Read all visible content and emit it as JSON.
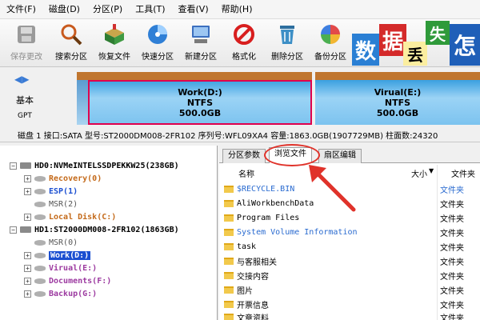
{
  "menu": [
    "文件(F)",
    "磁盘(D)",
    "分区(P)",
    "工具(T)",
    "查看(V)",
    "帮助(H)"
  ],
  "toolbar": {
    "save": "保存更改",
    "search": "搜索分区",
    "recover": "恢复文件",
    "quick": "快速分区",
    "new": "新建分区",
    "format": "格式化",
    "delete": "删除分区",
    "backup": "备份分区"
  },
  "ad_tiles": [
    "数",
    "据",
    "丢",
    "失",
    "怎"
  ],
  "disk_map": {
    "label1": "基本",
    "label2": "GPT",
    "partitions": [
      {
        "name": "Work(D:)",
        "fs": "NTFS",
        "size": "500.0GB"
      },
      {
        "name": "Virual(E:)",
        "fs": "NTFS",
        "size": "500.0GB"
      }
    ]
  },
  "info_line": "磁盘 1 接口:SATA  型号:ST2000DM008-2FR102  序列号:WFL09XA4  容量:1863.0GB(1907729MB)  柱面数:24320",
  "tree": {
    "hd0": "HD0:NVMeINTELSSDPEKKW25(238GB)",
    "hd0_parts": [
      "Recovery(0)",
      "ESP(1)",
      "MSR(2)",
      "Local Disk(C:)"
    ],
    "hd1": "HD1:ST2000DM008-2FR102(1863GB)",
    "hd1_parts": [
      "MSR(0)",
      "Work(D:)",
      "Virual(E:)",
      "Documents(F:)",
      "Backup(G:)"
    ]
  },
  "tabs": [
    "分区参数",
    "浏览文件",
    "扇区编辑"
  ],
  "columns": {
    "name": "名称",
    "size": "大小",
    "type": "文件夹"
  },
  "files": [
    {
      "name": "$RECYCLE.BIN",
      "type": "文件夹"
    },
    {
      "name": "AliWorkbenchData",
      "type": "文件夹"
    },
    {
      "name": "Program Files",
      "type": "文件夹"
    },
    {
      "name": "System Volume Information",
      "type": "文件夹"
    },
    {
      "name": "task",
      "type": "文件夹"
    },
    {
      "name": "与客服相关",
      "type": "文件夹"
    },
    {
      "name": "交接内容",
      "type": "文件夹"
    },
    {
      "name": "图片",
      "type": "文件夹"
    },
    {
      "name": "开票信息",
      "type": "文件夹"
    },
    {
      "name": "文章资料",
      "type": "文件夹"
    }
  ]
}
